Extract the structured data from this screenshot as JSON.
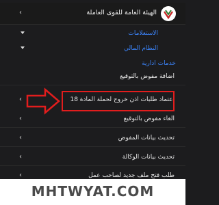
{
  "header": {
    "title": "الهيئة العامة للقوى العاملة",
    "chevron": "›"
  },
  "sections": [
    {
      "label": "الاستعلامات"
    },
    {
      "label": "النظام المالي"
    }
  ],
  "group": {
    "label": "خدمات ادارية"
  },
  "items": [
    {
      "label": "اضافة مفوض بالتوقيع",
      "chevron": "›"
    },
    {
      "label": "اعتماد طلبات اذن خروج لحملة المادة 18",
      "chevron": "›"
    },
    {
      "label": "الغاء مفوض بالتوقيع",
      "chevron": "›"
    },
    {
      "label": "تحديث بيانات المفوض",
      "chevron": "›"
    },
    {
      "label": "تحديث بيانات الوكالة",
      "chevron": "›"
    },
    {
      "label": "طلب فتح ملف جديد لصاحب عمل",
      "chevron": "›"
    }
  ],
  "annotation": {
    "arrow_color": "#e21d1d",
    "highlight_color": "#e21d1d"
  },
  "watermark": {
    "text": "MHTWYAT.COM"
  },
  "colors": {
    "background": "#1c1c1e",
    "accent": "#3b82f6",
    "text": "#e5e5e5"
  }
}
